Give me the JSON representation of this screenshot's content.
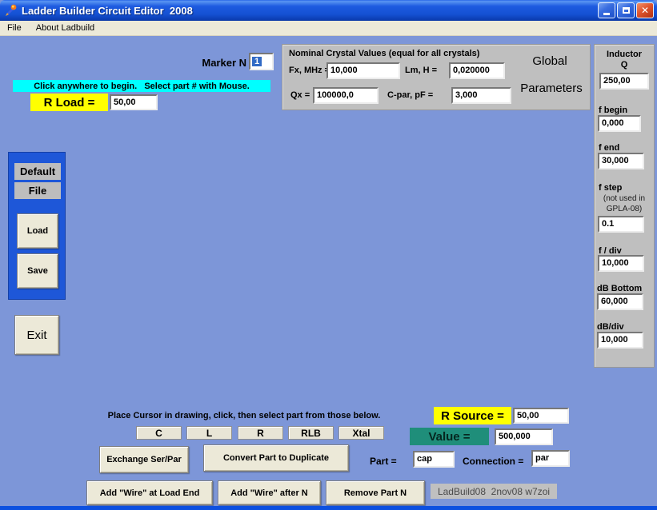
{
  "window": {
    "title": "Ladder Builder Circuit Editor  2008"
  },
  "menu": {
    "file": "File",
    "about": "About Ladbuild"
  },
  "marker": {
    "label": "Marker N",
    "value": "1"
  },
  "banner": "Click anywhere to begin.   Select part # with Mouse.",
  "r_load": {
    "label": "R Load =",
    "value": "50,00"
  },
  "crystal_panel": {
    "title": "Nominal Crystal Values (equal for all crystals)",
    "fx": {
      "label": "Fx, MHz =",
      "value": "10,000"
    },
    "lm": {
      "label": "Lm, H =",
      "value": "0,020000"
    },
    "qx": {
      "label": "Qx =",
      "value": "100000,0"
    },
    "cpar": {
      "label": "C-par, pF =",
      "value": "3,000"
    },
    "global_line1": "Global",
    "global_line2": "Parameters"
  },
  "right_panel": {
    "inductor_line1": "Inductor",
    "inductor_line2": "Q",
    "inductor_value": "250,00",
    "f_begin": {
      "label": "f begin",
      "value": "0,000"
    },
    "f_end": {
      "label": "f end",
      "value": "30,000"
    },
    "f_step": {
      "label": "f step",
      "note1": "(not used in",
      "note2": "GPLA-08)",
      "value": "0.1"
    },
    "f_div": {
      "label": "f / div",
      "value": "10,000"
    },
    "db_bottom": {
      "label": "dB Bottom",
      "value": "60,000"
    },
    "db_div": {
      "label": "dB/div",
      "value": "10,000"
    }
  },
  "file_panel": {
    "default_label": "Default",
    "file_label": "File",
    "load": "Load",
    "save": "Save"
  },
  "exit_label": "Exit",
  "bottom": {
    "instruction": "Place Cursor in drawing, click, then select part from those below.",
    "part_buttons": [
      "C",
      "L",
      "R",
      "RLB",
      "Xtal"
    ],
    "r_source": {
      "label": "R Source =",
      "value": "50,00"
    },
    "value": {
      "label": "Value =",
      "value": "500,000"
    },
    "exchange": "Exchange Ser/Par",
    "convert": "Convert Part to Duplicate",
    "part": {
      "label": "Part =",
      "value": "cap"
    },
    "connection": {
      "label": "Connection =",
      "value": "par"
    },
    "add_wire_load": "Add \"Wire\" at Load End",
    "add_wire_n": "Add \"Wire\" after N",
    "remove_part": "Remove Part N",
    "version": "LadBuild08  2nov08 w7zoi"
  },
  "colors": {
    "background": "#7D96D8",
    "banner_cyan": "#00FFFF",
    "label_yellow": "#FFFF00",
    "value_teal": "#1F8E7A",
    "panel_gray": "#BFBFBF",
    "side_panel_blue": "#1E57D8",
    "bottom_border_blue": "#0C50E0"
  }
}
